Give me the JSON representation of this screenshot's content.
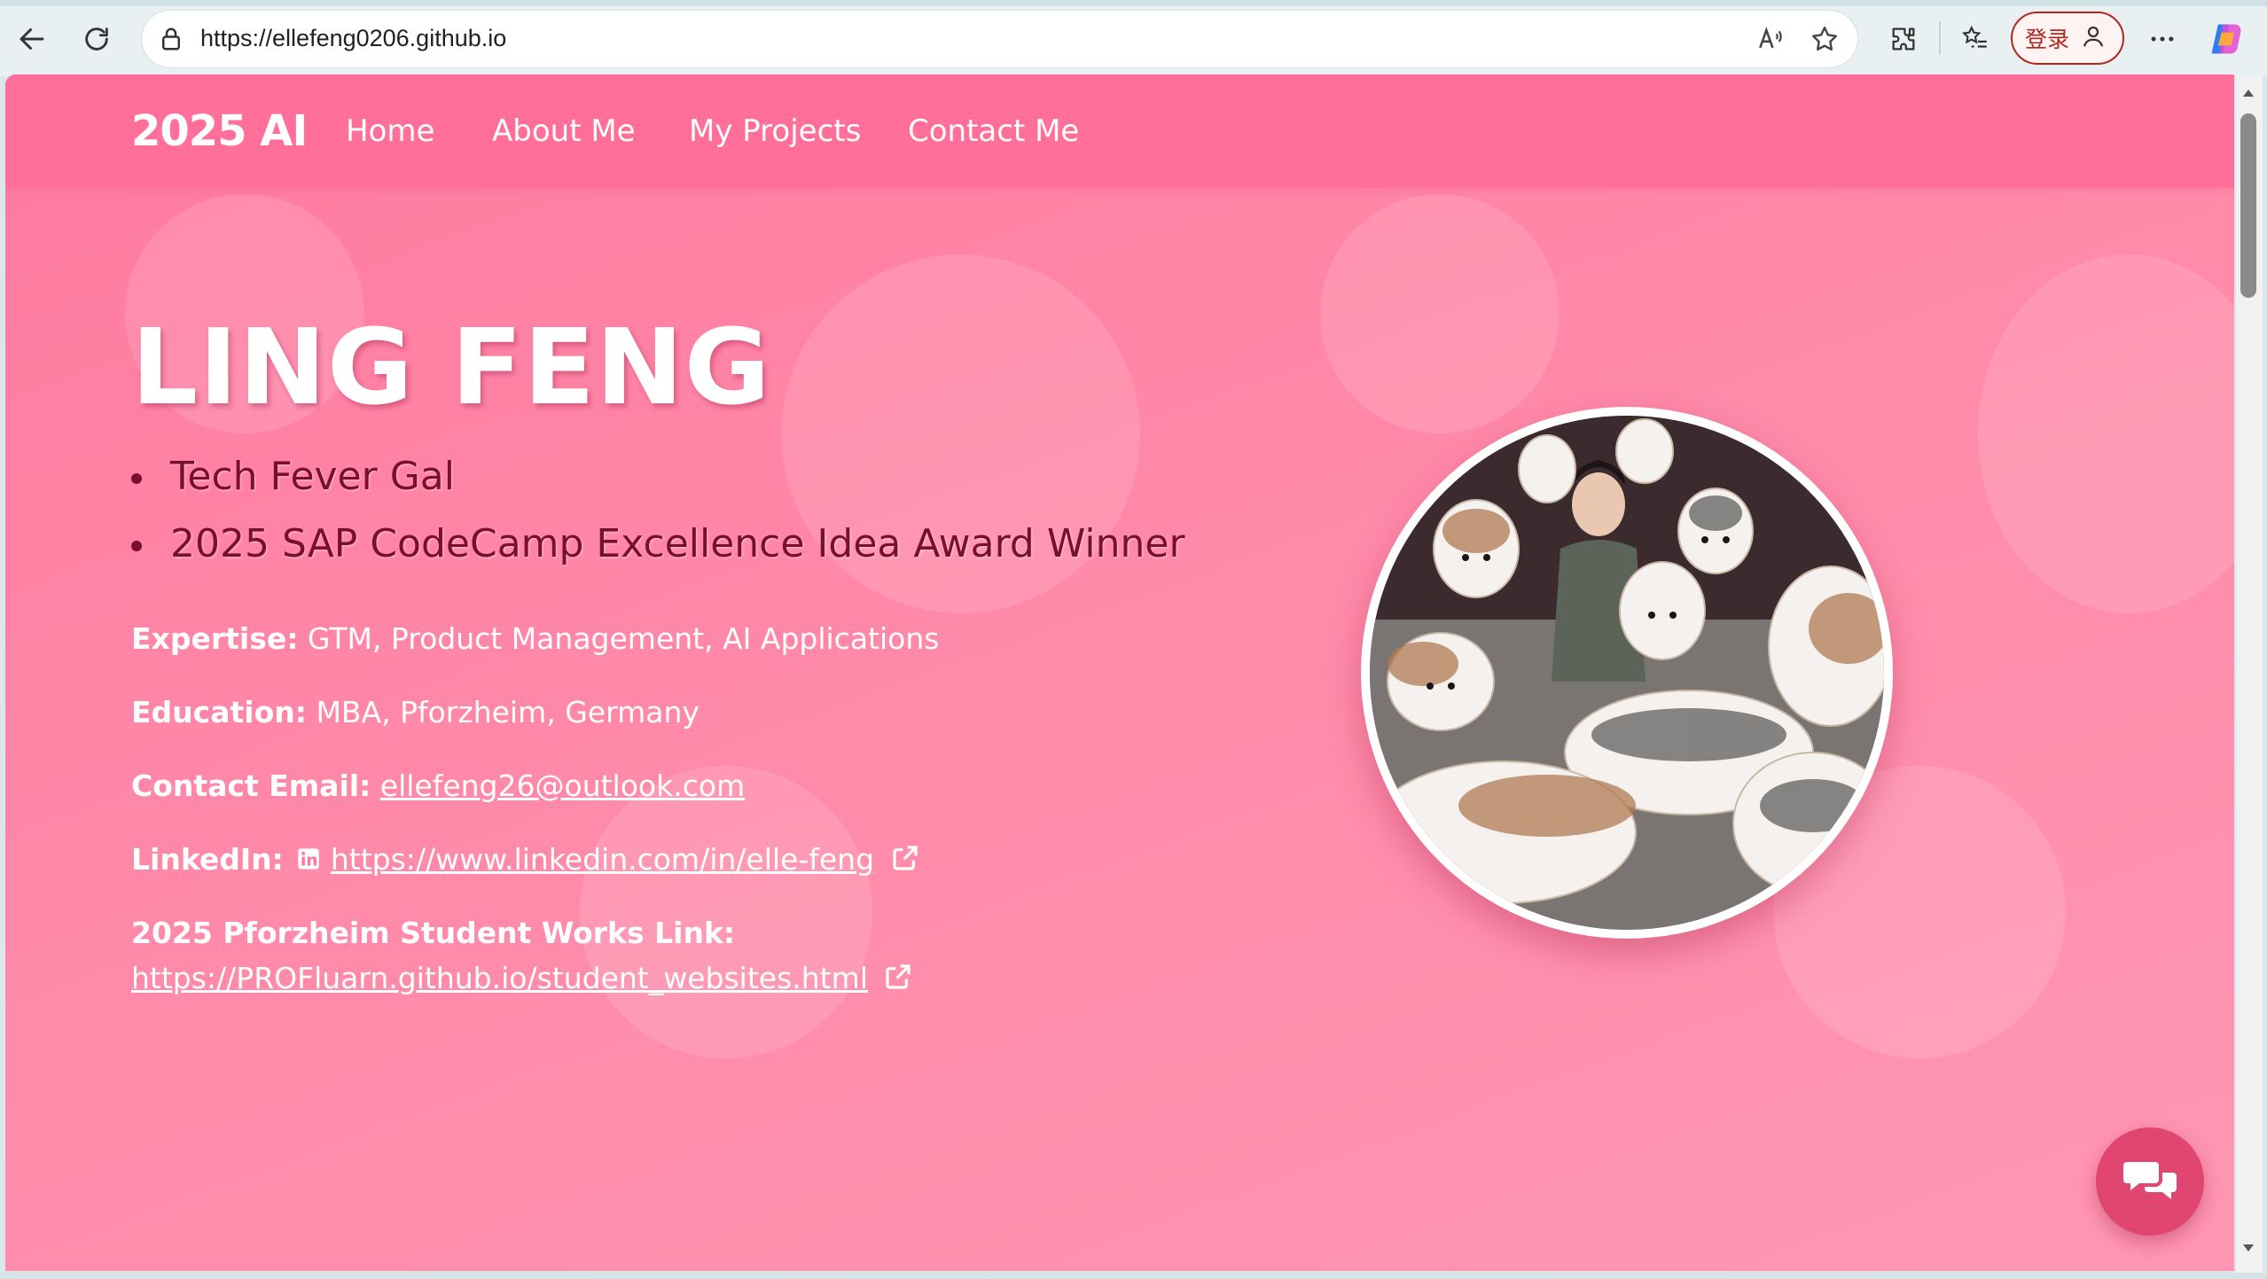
{
  "browser": {
    "url": "https://ellefeng0206.github.io",
    "login_label": "登录"
  },
  "site": {
    "brand": "2025 AI",
    "nav": [
      {
        "label": "Home"
      },
      {
        "label": "About Me"
      },
      {
        "label": "My Projects"
      },
      {
        "label": "Contact Me"
      }
    ]
  },
  "hero": {
    "name": "LING FENG",
    "taglines": [
      "Tech Fever Gal",
      "2025 SAP CodeCamp Excellence Idea Award Winner"
    ],
    "expertise_label": "Expertise:",
    "expertise_value": "GTM, Product Management, AI Applications",
    "education_label": "Education:",
    "education_value": "MBA, Pforzheim, Germany",
    "email_label": "Contact Email:",
    "email_value": "ellefeng26@outlook.com",
    "linkedin_label": "LinkedIn:",
    "linkedin_value": "https://www.linkedin.com/in/elle-feng",
    "works_label": "2025 Pforzheim Student Works Link:",
    "works_value": "https://PROFluarn.github.io/student_websites.html"
  },
  "colors": {
    "page_bg": "#ff89a9",
    "nav_bg": "#ff6f99",
    "tagline": "#7a0e2e",
    "chat_button": "#e0466f"
  }
}
